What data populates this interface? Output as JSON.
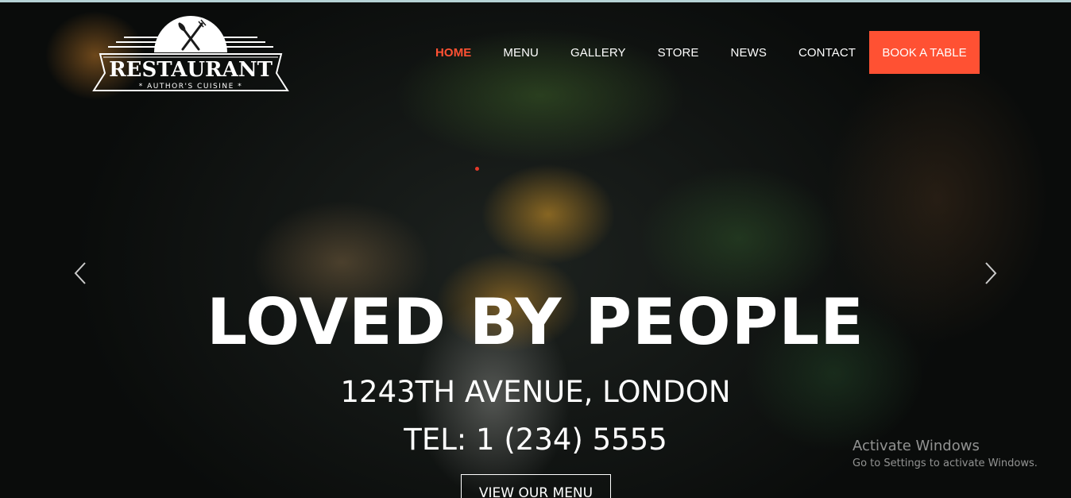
{
  "brand": {
    "name": "RESTAURANT",
    "tagline": "AUTHOR'S CUISINE"
  },
  "nav": {
    "items": [
      {
        "label": "HOME",
        "active": true
      },
      {
        "label": "MENU",
        "active": false
      },
      {
        "label": "GALLERY",
        "active": false
      },
      {
        "label": "STORE",
        "active": false
      },
      {
        "label": "NEWS",
        "active": false
      },
      {
        "label": "CONTACT",
        "active": false
      }
    ],
    "cta_label": "BOOK A TABLE"
  },
  "hero": {
    "headline": "LOVED BY PEOPLE",
    "address": "1243TH AVENUE, LONDON",
    "tel": "TEL: 1 (234) 5555",
    "button_label": "VIEW OUR MENU"
  },
  "watermark": {
    "title": "Activate Windows",
    "subtitle": "Go to Settings to activate Windows."
  },
  "icons": {
    "logo_emblem": "fork-knife-icon",
    "prev": "chevron-left-icon",
    "next": "chevron-right-icon"
  },
  "colors": {
    "accent": "#ff5133",
    "text": "#ffffff"
  }
}
